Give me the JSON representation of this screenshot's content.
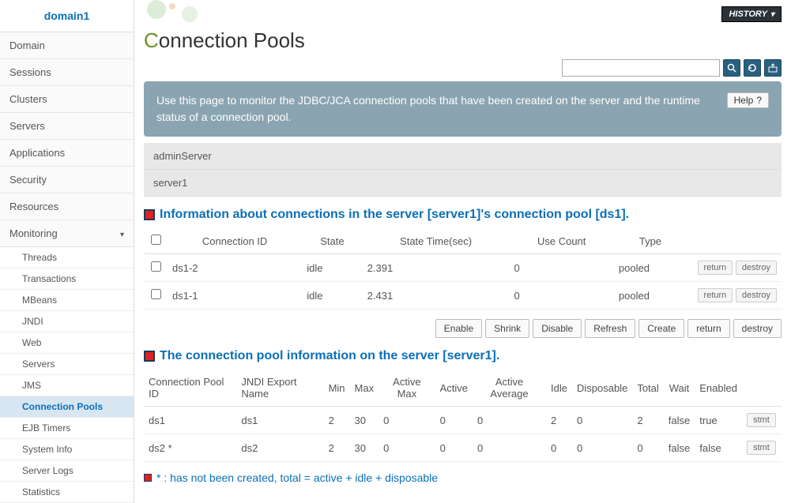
{
  "sidebar": {
    "title": "domain1",
    "items": [
      "Domain",
      "Sessions",
      "Clusters",
      "Servers",
      "Applications",
      "Security",
      "Resources"
    ],
    "monitoring_label": "Monitoring",
    "subitems": [
      "Threads",
      "Transactions",
      "MBeans",
      "JNDI",
      "Web",
      "Servers",
      "JMS",
      "Connection Pools",
      "EJB Timers",
      "System Info",
      "Server Logs",
      "Statistics"
    ]
  },
  "header": {
    "history_label": "HISTORY",
    "page_title_accent": "C",
    "page_title_rest": "onnection Pools",
    "search_placeholder": ""
  },
  "banner": {
    "text": "Use this page to monitor the JDBC/JCA connection pools that have been created on the server and the runtime status of a connection pool.",
    "help_label": "Help"
  },
  "servers": [
    "adminServer",
    "server1"
  ],
  "section1": {
    "title": "Information about connections in the server [server1]'s connection pool [ds1].",
    "cols": [
      "Connection ID",
      "State",
      "State Time(sec)",
      "Use Count",
      "Type"
    ],
    "rows": [
      {
        "id": "ds1-2",
        "state": "idle",
        "time": "2.391",
        "count": "0",
        "type": "pooled"
      },
      {
        "id": "ds1-1",
        "state": "idle",
        "time": "2.431",
        "count": "0",
        "type": "pooled"
      }
    ],
    "row_actions": [
      "return",
      "destroy"
    ]
  },
  "actions": [
    "Enable",
    "Shrink",
    "Disable",
    "Refresh",
    "Create",
    "return",
    "destroy"
  ],
  "section2": {
    "title": "The connection pool information on the server [server1].",
    "cols": [
      "Connection Pool ID",
      "JNDI Export Name",
      "Min",
      "Max",
      "Active Max",
      "Active",
      "Active Average",
      "Idle",
      "Disposable",
      "Total",
      "Wait",
      "Enabled"
    ],
    "rows": [
      {
        "cells": [
          "ds1",
          "ds1",
          "2",
          "30",
          "0",
          "0",
          "0",
          "2",
          "0",
          "2",
          "false",
          "true"
        ],
        "btn": "stmt"
      },
      {
        "cells": [
          "ds2 *",
          "ds2",
          "2",
          "30",
          "0",
          "0",
          "0",
          "0",
          "0",
          "0",
          "false",
          "false"
        ],
        "btn": "stmt"
      }
    ]
  },
  "footnote": "* : has not been created, total = active + idle + disposable"
}
